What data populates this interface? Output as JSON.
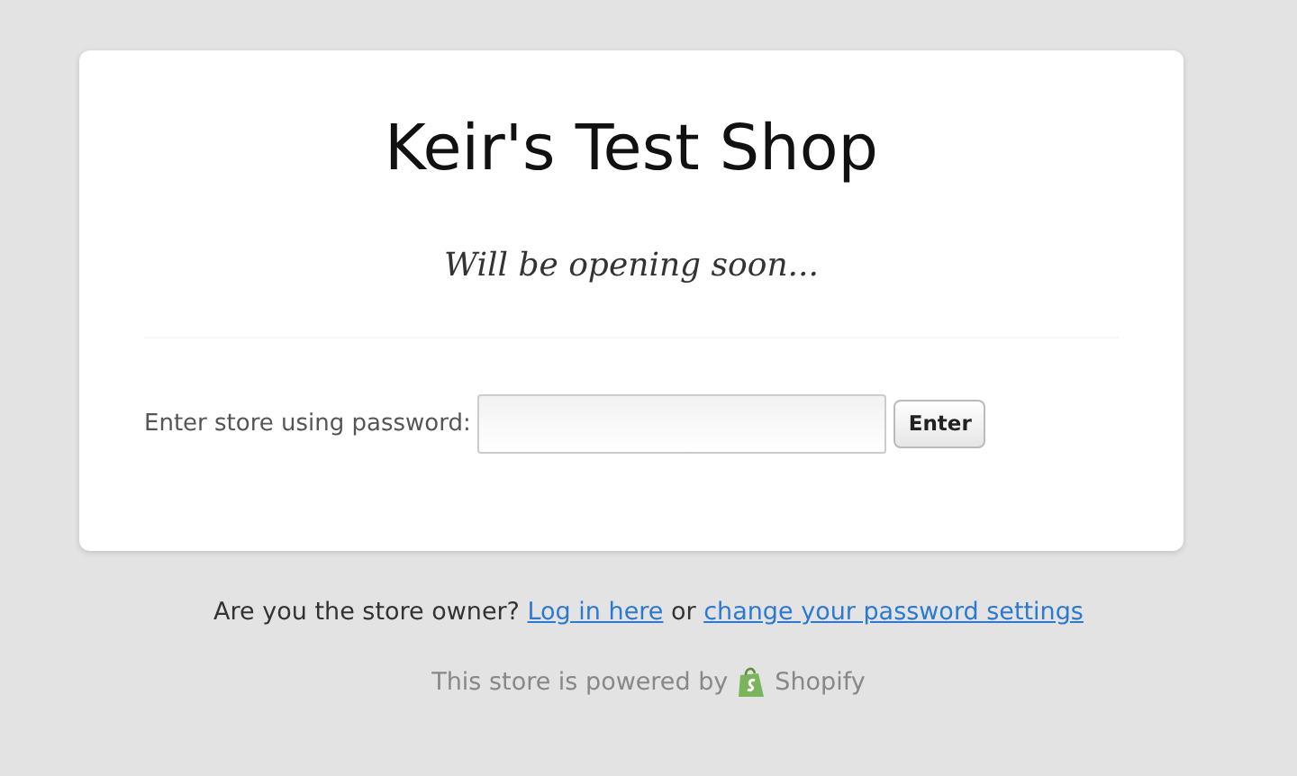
{
  "shop_title": "Keir's Test Shop",
  "tagline": "Will be opening soon...",
  "password_form": {
    "label": "Enter store using password:",
    "button": "Enter"
  },
  "owner_prompt": {
    "text_before": "Are you the store owner?",
    "login_link": "Log in here",
    "text_between": "or",
    "settings_link": "change your password settings"
  },
  "powered_by": {
    "text": "This store is powered by",
    "brand": "Shopify"
  }
}
